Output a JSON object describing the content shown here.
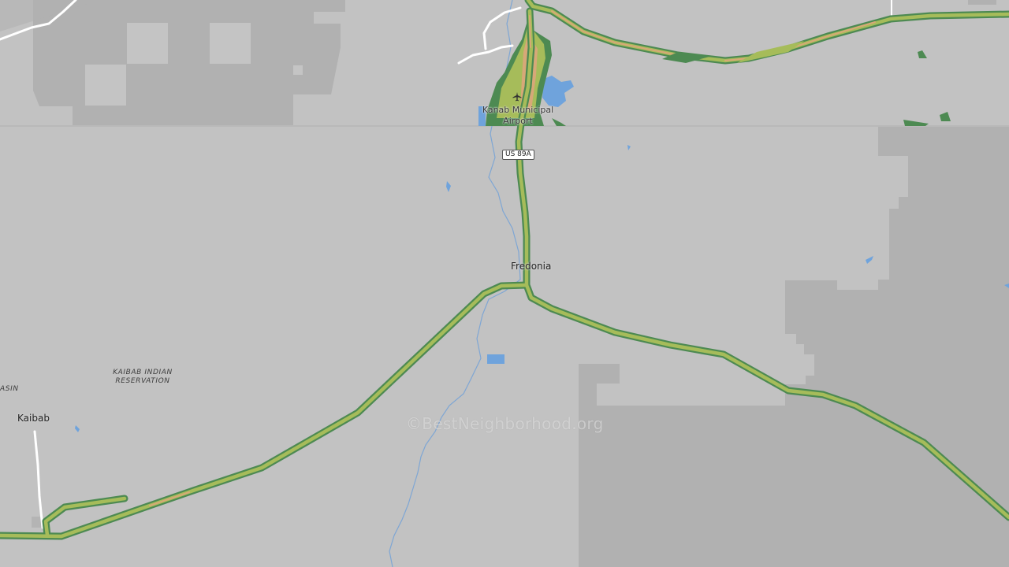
{
  "map": {
    "places": {
      "fredonia": "Fredonia",
      "kaibab": "Kaibab"
    },
    "airport_line1": "Kanab Municipal",
    "airport_line2": "Airport",
    "highway_shield": "US 89A",
    "reservation_line1": "KAIBAB INDIAN",
    "reservation_line2": "RESERVATION",
    "basin_fragment": "ASIN",
    "watermark": "©BestNeighborhood.org",
    "icons": {
      "airport": "airplane-icon"
    },
    "colors": {
      "background": "#c2c2c2",
      "public_land": "#b1b1b1",
      "water": "#6fa3dc",
      "road_outline": "#4d8a52",
      "road_fill": "#a6bc5a",
      "heat_high": "#d7a878",
      "minor_road": "#ffffff"
    }
  }
}
